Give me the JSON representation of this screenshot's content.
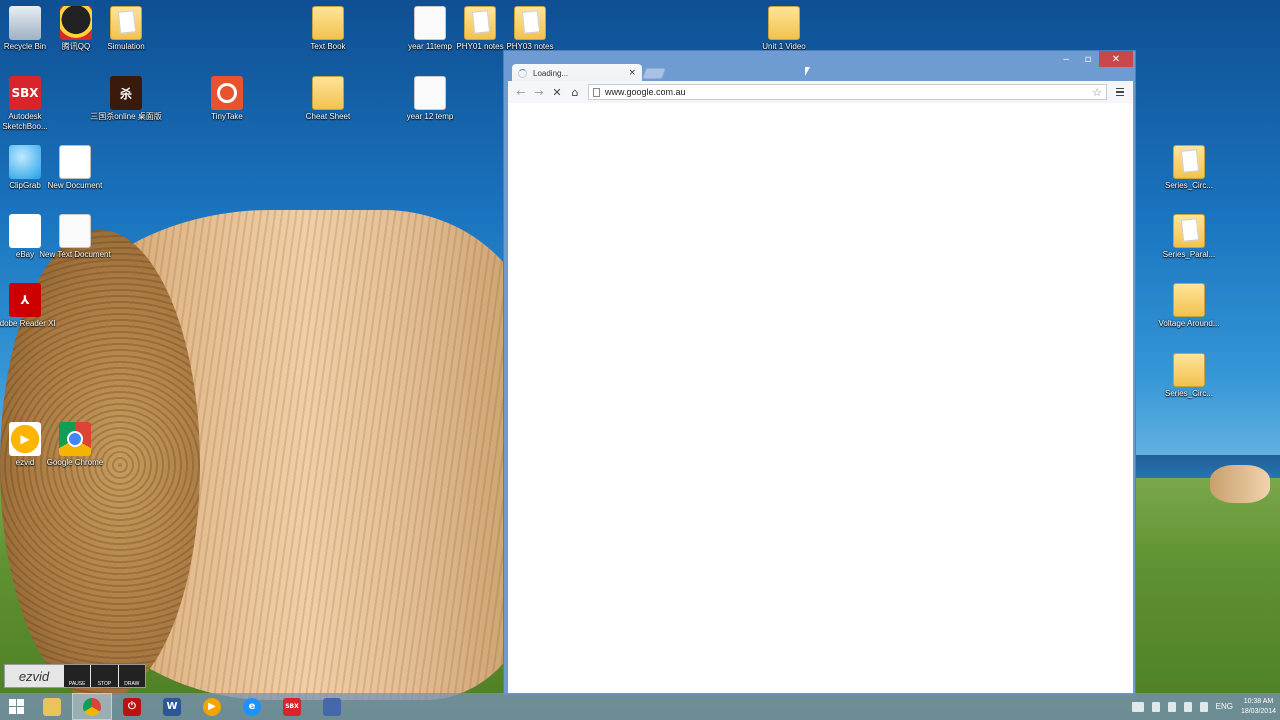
{
  "desktop": {
    "icons": [
      {
        "label": "Recycle Bin"
      },
      {
        "label": "腾讯QQ"
      },
      {
        "label": "Simulation"
      },
      {
        "label": "Text Book"
      },
      {
        "label": "year 11temp"
      },
      {
        "label": "PHY01 notes"
      },
      {
        "label": "PHY03 notes"
      },
      {
        "label": "Unit 1 Video"
      },
      {
        "label": "Autodesk SketchBoo..."
      },
      {
        "label": "三国杀online 桌面版"
      },
      {
        "label": "TinyTake"
      },
      {
        "label": "Cheat Sheet"
      },
      {
        "label": "year 12 temp"
      },
      {
        "label": "ClipGrab"
      },
      {
        "label": "New Document"
      },
      {
        "label": "eBay"
      },
      {
        "label": "New Text Document"
      },
      {
        "label": "Adobe Reader XI"
      },
      {
        "label": "ezvid"
      },
      {
        "label": "Google Chrome"
      },
      {
        "label": "Series_Circ..."
      },
      {
        "label": "Series_Paral..."
      },
      {
        "label": "Voltage Around..."
      },
      {
        "label": "Series_Circ..."
      }
    ],
    "glyphs": {
      "sbx": "SBX",
      "sanguo": "杀",
      "word": "W",
      "ebay": "ebay",
      "adobe": "⅄",
      "ezvid": "▶"
    }
  },
  "browser": {
    "tab_title": "Loading...",
    "tab_close": "×",
    "url": "www.google.com.au",
    "back": "←",
    "forward": "→",
    "stop": "✕",
    "home": "⌂",
    "star": "☆",
    "window_min": "‒",
    "window_max": "▫",
    "window_close": "✕"
  },
  "ezvid_bar": {
    "logo": "ezvid",
    "buttons": [
      "PAUSE",
      "STOP",
      "DRAW"
    ]
  },
  "taskbar": {
    "apps": [
      "File Explorer",
      "Google Chrome",
      "Power",
      "Word",
      "Media Player",
      "Internet Explorer",
      "SketchBook",
      "Network"
    ],
    "tray": {
      "language": "ENG",
      "time": "10:38 AM",
      "date": "18/03/2014"
    }
  },
  "colors": {
    "window_frame": "#6e9bd1",
    "close_button": "#c7474a",
    "taskbar": "#7891b9"
  }
}
